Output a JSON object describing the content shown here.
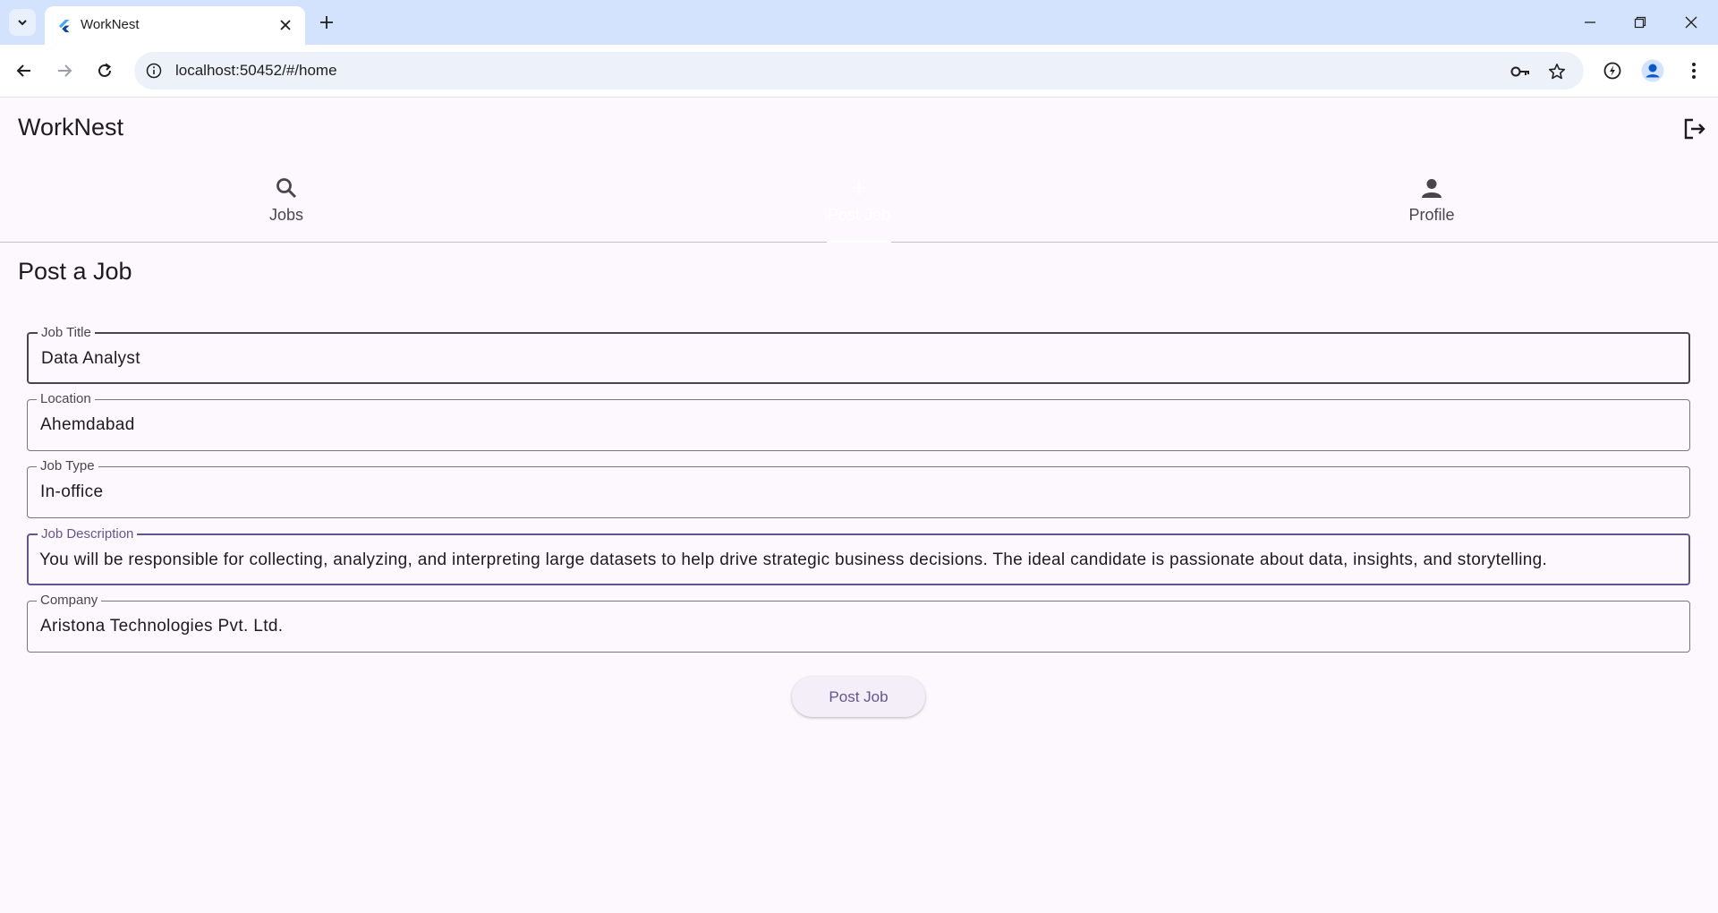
{
  "browser": {
    "tab_title": "WorkNest",
    "url": "localhost:50452/#/home"
  },
  "app": {
    "title": "WorkNest",
    "nav_tabs": [
      {
        "label": "Jobs",
        "icon": "search-icon"
      },
      {
        "label": "Post Job",
        "icon": "plus-icon"
      },
      {
        "label": "Profile",
        "icon": "person-icon"
      }
    ],
    "active_tab": "Post Job"
  },
  "form": {
    "heading": "Post a Job",
    "fields": [
      {
        "label": "Job Title",
        "value": "Data Analyst"
      },
      {
        "label": "Location",
        "value": "Ahemdabad"
      },
      {
        "label": "Job Type",
        "value": "In-office"
      },
      {
        "label": "Job Description",
        "value": "You will be responsible for collecting, analyzing, and interpreting large datasets to help drive strategic business decisions. The ideal candidate is passionate about data, insights, and storytelling."
      },
      {
        "label": "Company",
        "value": "Aristona Technologies Pvt. Ltd."
      }
    ],
    "submit_label": "Post Job"
  },
  "colors": {
    "background": "#fdf7fe",
    "primary": "#65558f",
    "browser_frame": "#d3e3fd"
  }
}
